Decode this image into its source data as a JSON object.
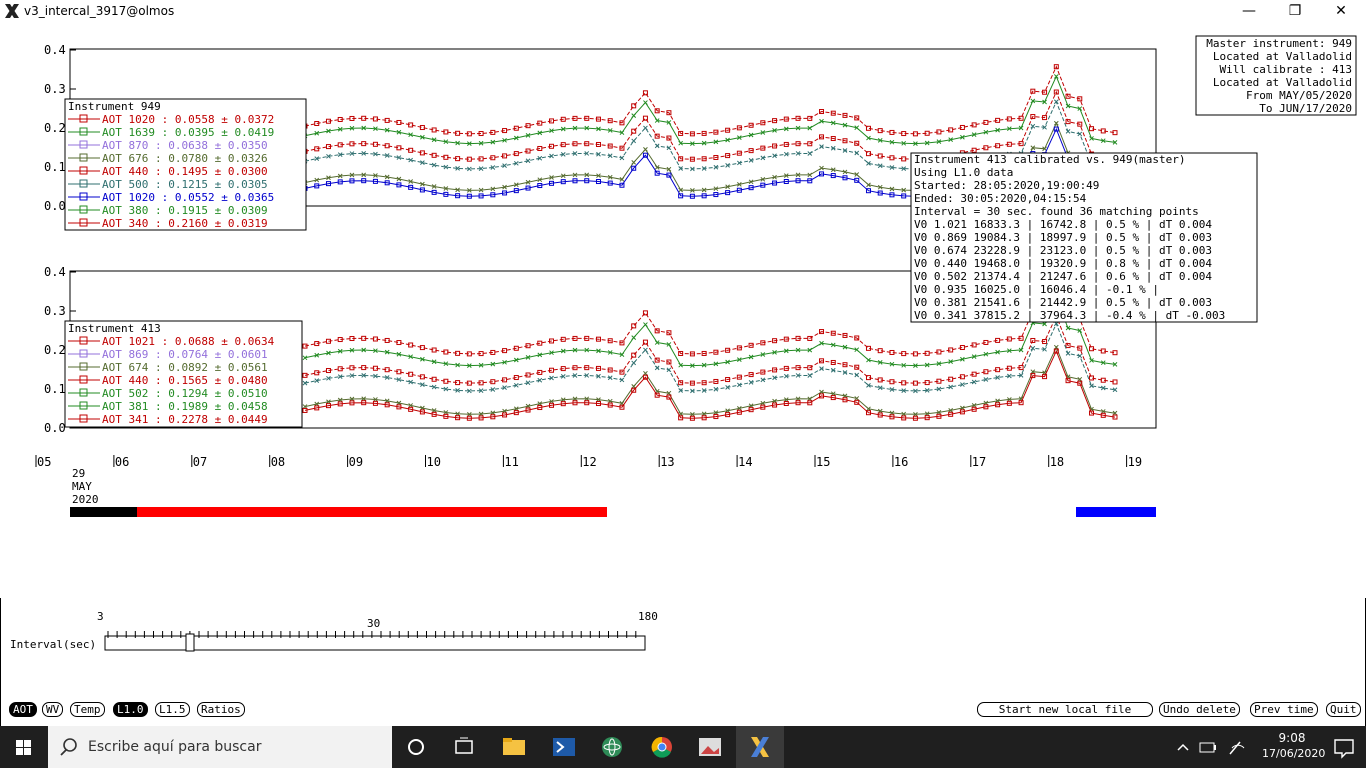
{
  "window": {
    "title": "v3_intercal_3917@olmos",
    "minimize": "—",
    "maximize": "❐",
    "close": "✕"
  },
  "info_top_right": [
    "Master instrument: 949",
    "Located at Valladolid",
    "Will calibrate   : 413",
    "Located at Valladolid",
    "From MAY/05/2020",
    "To JUN/17/2020"
  ],
  "upper_chart": {
    "yticks": [
      "0.4",
      "0.3",
      "0.2",
      "0.1",
      "0.0"
    ],
    "legend_title": "Instrument 949",
    "legend": [
      {
        "text": "AOT 1020 :    0.0558 ± 0.0372",
        "color": "#c00000"
      },
      {
        "text": "AOT 1639 :    0.0395 ± 0.0419",
        "color": "#228b22"
      },
      {
        "text": "AOT 870  :    0.0638 ± 0.0350",
        "color": "#9370db"
      },
      {
        "text": "AOT 676  :    0.0780 ± 0.0326",
        "color": "#556b2f"
      },
      {
        "text": "AOT 440  :    0.1495 ± 0.0300",
        "color": "#c00000"
      },
      {
        "text": "AOT 500  :    0.1215 ± 0.0305",
        "color": "#2f6f6f"
      },
      {
        "text": "AOT 1020 :    0.0552 ± 0.0365",
        "color": "#0000cd"
      },
      {
        "text": "AOT 380  :    0.1915 ± 0.0309",
        "color": "#228b22"
      },
      {
        "text": "AOT 340  :    0.2160 ± 0.0319",
        "color": "#c00000"
      }
    ]
  },
  "lower_chart": {
    "yticks": [
      "0.4",
      "0.3",
      "0.2",
      "0.1",
      "0.0"
    ],
    "legend_title": "Instrument 413",
    "legend": [
      {
        "text": "AOT 1021 :    0.0688 ± 0.0634",
        "color": "#c00000"
      },
      {
        "text": "AOT 869  :    0.0764 ± 0.0601",
        "color": "#9370db"
      },
      {
        "text": "AOT 674  :    0.0892 ± 0.0561",
        "color": "#556b2f"
      },
      {
        "text": "AOT 440  :    0.1565 ± 0.0480",
        "color": "#c00000"
      },
      {
        "text": "AOT 502  :    0.1294 ± 0.0510",
        "color": "#228b22"
      },
      {
        "text": "AOT 381  :    0.1989 ± 0.0458",
        "color": "#228b22"
      },
      {
        "text": "AOT 341  :    0.2278 ± 0.0449",
        "color": "#c00000"
      }
    ]
  },
  "calib_box": [
    "Instrument 413 calibrated vs. 949(master)",
    "Using L1.0 data",
    "Started: 28:05:2020,19:00:49",
    "Ended: 30:05:2020,04:15:54",
    "Interval = 30 sec. found 36 matching points",
    "V0 1.021  16833.3 | 16742.8 |  0.5 % | dT 0.004",
    "V0 0.869  19084.3 | 18997.9 |  0.5 % | dT 0.003",
    "V0 0.674  23228.9 | 23123.0 |  0.5 % | dT 0.003",
    "V0 0.440  19468.0 | 19320.9 |  0.8 % | dT 0.004",
    "V0 0.502  21374.4 | 21247.6 |  0.6 % | dT 0.004",
    "V0 0.935  16025.0 | 16046.4 | -0.1 % |",
    "V0 0.381  21541.6 | 21442.9 |  0.5 % | dT 0.003",
    "V0 0.341  37815.2 | 37964.3 | -0.4 % | dT -0.003"
  ],
  "x_axis": {
    "ticks": [
      "05",
      "06",
      "07",
      "08",
      "09",
      "10",
      "11",
      "12",
      "13",
      "14",
      "15",
      "16",
      "17",
      "18",
      "19"
    ],
    "date_label": [
      "29",
      "MAY",
      "2020"
    ]
  },
  "slider": {
    "label": "Interval(sec)",
    "min": "3",
    "mid": "30",
    "max": "180",
    "value": 30
  },
  "buttons_left": [
    {
      "label": "AOT",
      "selected": true
    },
    {
      "label": "WV",
      "selected": false
    },
    {
      "label": "Temp",
      "selected": false
    },
    {
      "label": "L1.0",
      "selected": true
    },
    {
      "label": "L1.5",
      "selected": false
    },
    {
      "label": "Ratios",
      "selected": false
    }
  ],
  "buttons_right": [
    "Start new local file",
    "Undo delete",
    "Prev time",
    "Quit"
  ],
  "taskbar": {
    "search_placeholder": "Escribe aquí para buscar",
    "time": "9:08",
    "date": "17/06/2020"
  },
  "colors": {
    "red": "#ff0000",
    "blue": "#0000ff",
    "black": "#000000"
  }
}
